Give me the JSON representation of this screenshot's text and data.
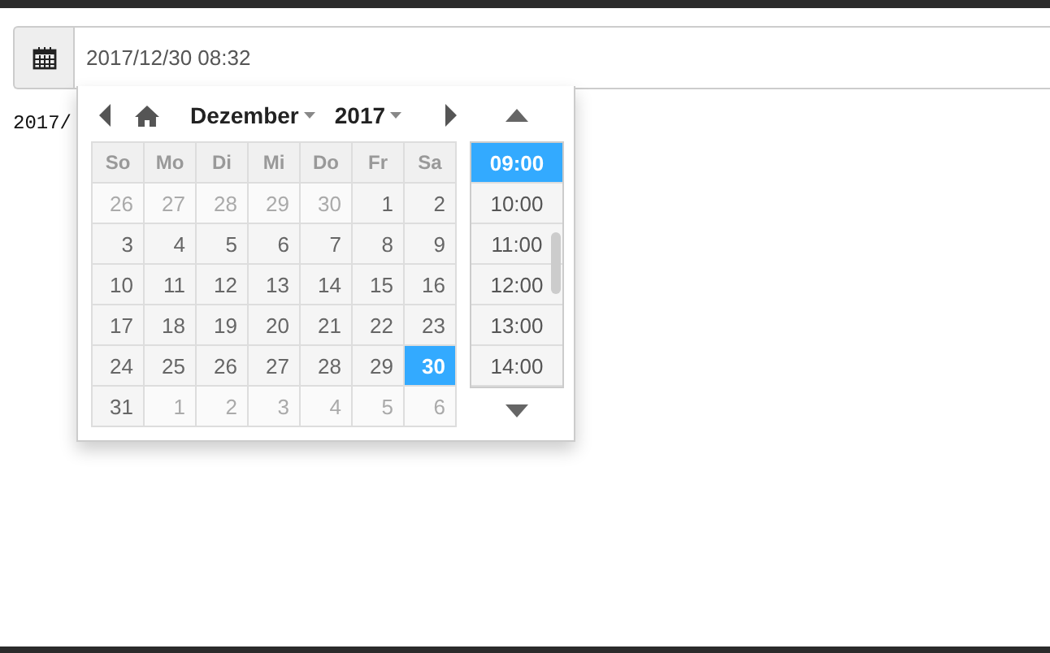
{
  "input": {
    "value": "2017/12/30 08:32"
  },
  "background_text": "2017/",
  "picker": {
    "month": "Dezember",
    "year": "2017",
    "weekdays": [
      "So",
      "Mo",
      "Di",
      "Mi",
      "Do",
      "Fr",
      "Sa"
    ],
    "weeks": [
      [
        {
          "day": "26",
          "other_month": true,
          "selected": false
        },
        {
          "day": "27",
          "other_month": true,
          "selected": false
        },
        {
          "day": "28",
          "other_month": true,
          "selected": false
        },
        {
          "day": "29",
          "other_month": true,
          "selected": false
        },
        {
          "day": "30",
          "other_month": true,
          "selected": false
        },
        {
          "day": "1",
          "other_month": false,
          "selected": false
        },
        {
          "day": "2",
          "other_month": false,
          "selected": false
        }
      ],
      [
        {
          "day": "3",
          "other_month": false,
          "selected": false
        },
        {
          "day": "4",
          "other_month": false,
          "selected": false
        },
        {
          "day": "5",
          "other_month": false,
          "selected": false
        },
        {
          "day": "6",
          "other_month": false,
          "selected": false
        },
        {
          "day": "7",
          "other_month": false,
          "selected": false
        },
        {
          "day": "8",
          "other_month": false,
          "selected": false
        },
        {
          "day": "9",
          "other_month": false,
          "selected": false
        }
      ],
      [
        {
          "day": "10",
          "other_month": false,
          "selected": false
        },
        {
          "day": "11",
          "other_month": false,
          "selected": false
        },
        {
          "day": "12",
          "other_month": false,
          "selected": false
        },
        {
          "day": "13",
          "other_month": false,
          "selected": false
        },
        {
          "day": "14",
          "other_month": false,
          "selected": false
        },
        {
          "day": "15",
          "other_month": false,
          "selected": false
        },
        {
          "day": "16",
          "other_month": false,
          "selected": false
        }
      ],
      [
        {
          "day": "17",
          "other_month": false,
          "selected": false
        },
        {
          "day": "18",
          "other_month": false,
          "selected": false
        },
        {
          "day": "19",
          "other_month": false,
          "selected": false
        },
        {
          "day": "20",
          "other_month": false,
          "selected": false
        },
        {
          "day": "21",
          "other_month": false,
          "selected": false
        },
        {
          "day": "22",
          "other_month": false,
          "selected": false
        },
        {
          "day": "23",
          "other_month": false,
          "selected": false
        }
      ],
      [
        {
          "day": "24",
          "other_month": false,
          "selected": false
        },
        {
          "day": "25",
          "other_month": false,
          "selected": false
        },
        {
          "day": "26",
          "other_month": false,
          "selected": false
        },
        {
          "day": "27",
          "other_month": false,
          "selected": false
        },
        {
          "day": "28",
          "other_month": false,
          "selected": false
        },
        {
          "day": "29",
          "other_month": false,
          "selected": false
        },
        {
          "day": "30",
          "other_month": false,
          "selected": true
        }
      ],
      [
        {
          "day": "31",
          "other_month": false,
          "selected": false
        },
        {
          "day": "1",
          "other_month": true,
          "selected": false
        },
        {
          "day": "2",
          "other_month": true,
          "selected": false
        },
        {
          "day": "3",
          "other_month": true,
          "selected": false
        },
        {
          "day": "4",
          "other_month": true,
          "selected": false
        },
        {
          "day": "5",
          "other_month": true,
          "selected": false
        },
        {
          "day": "6",
          "other_month": true,
          "selected": false
        }
      ]
    ],
    "times": [
      {
        "label": "09:00",
        "selected": true
      },
      {
        "label": "10:00",
        "selected": false
      },
      {
        "label": "11:00",
        "selected": false
      },
      {
        "label": "12:00",
        "selected": false
      },
      {
        "label": "13:00",
        "selected": false
      },
      {
        "label": "14:00",
        "selected": false
      }
    ]
  }
}
